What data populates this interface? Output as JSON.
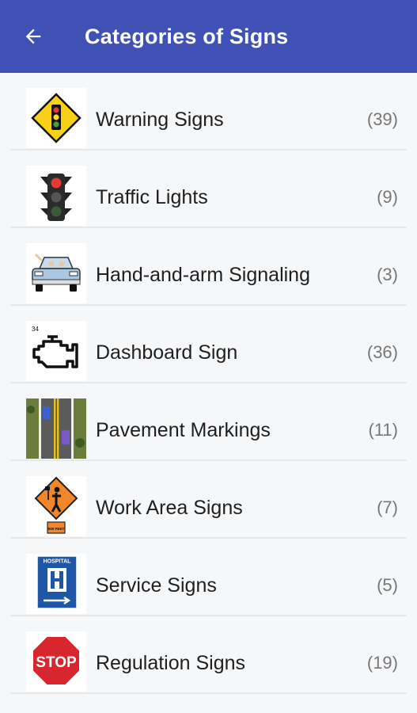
{
  "appbar": {
    "title": "Categories of Signs",
    "back_icon": "arrow-left-icon"
  },
  "categories": [
    {
      "label": "Warning Signs",
      "count": "(39)",
      "icon": "warning-sign-icon"
    },
    {
      "label": "Traffic Lights",
      "count": "(9)",
      "icon": "traffic-light-icon"
    },
    {
      "label": "Hand-and-arm Signaling",
      "count": "(3)",
      "icon": "car-icon"
    },
    {
      "label": "Dashboard Sign",
      "count": "(36)",
      "icon": "engine-icon",
      "icon_text": "34"
    },
    {
      "label": "Pavement Markings",
      "count": "(11)",
      "icon": "road-icon"
    },
    {
      "label": "Work Area Signs",
      "count": "(7)",
      "icon": "flagger-sign-icon",
      "icon_text": "500 FEET"
    },
    {
      "label": "Service Signs",
      "count": "(5)",
      "icon": "hospital-sign-icon",
      "icon_text": "HOSPITAL"
    },
    {
      "label": "Regulation Signs",
      "count": "(19)",
      "icon": "stop-sign-icon",
      "icon_text": "STOP"
    }
  ],
  "colors": {
    "appbar": "#3f51b5",
    "background": "#f6f7f9"
  }
}
